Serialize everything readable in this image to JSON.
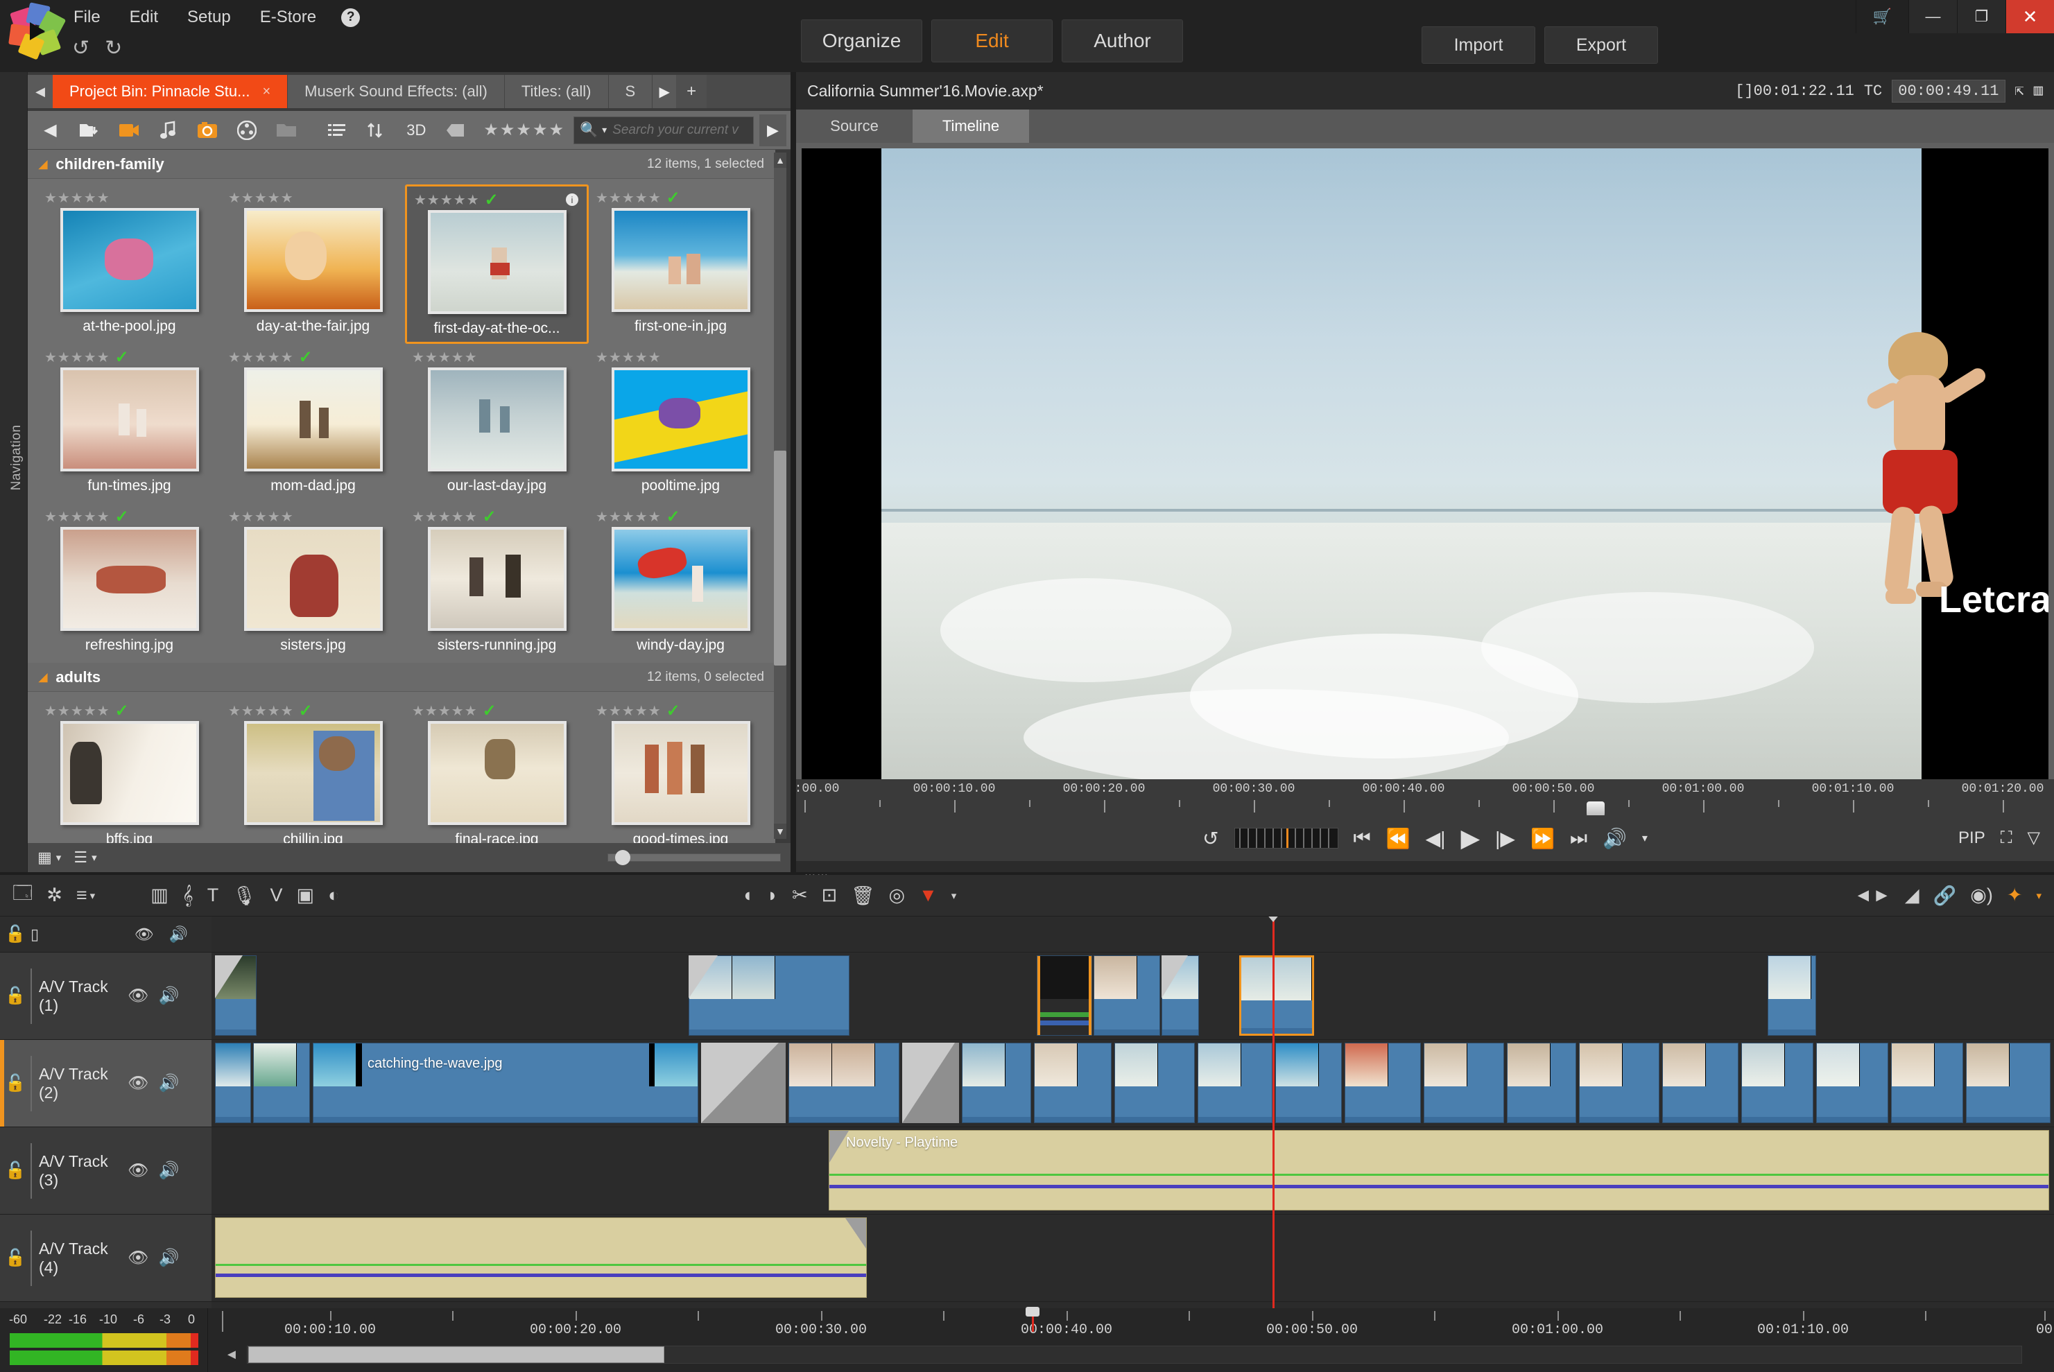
{
  "app": {
    "menu": [
      "File",
      "Edit",
      "Setup",
      "E-Store"
    ],
    "help_icon": "?",
    "undo_icon": "↺",
    "redo_icon": "↻",
    "logo_icon": "pinnacle-logo"
  },
  "modes": [
    {
      "label": "Organize",
      "active": false
    },
    {
      "label": "Edit",
      "active": true
    },
    {
      "label": "Author",
      "active": false
    }
  ],
  "io": [
    {
      "label": "Import"
    },
    {
      "label": "Export"
    }
  ],
  "window_controls": {
    "cart": "🛒",
    "minimize": "—",
    "maximize": "❐",
    "close": "✕"
  },
  "library": {
    "nav_label": "Navigation",
    "tab_scroll_left": "◀",
    "tab_scroll_right": "▶",
    "tab_add": "+",
    "tabs": [
      {
        "label": "Project Bin: Pinnacle Stu...",
        "active": true,
        "close": "×"
      },
      {
        "label": "Muserk Sound Effects: (all)",
        "active": false
      },
      {
        "label": "Titles: (all)",
        "active": false
      },
      {
        "label": "S",
        "active": false
      }
    ],
    "toolbar": [
      {
        "name": "import-folder-icon",
        "glyph": "🗀",
        "accent": false
      },
      {
        "name": "video-icon",
        "glyph": "🎞",
        "accent": true
      },
      {
        "name": "music-note-icon",
        "glyph": "♪",
        "accent": false
      },
      {
        "name": "photo-icon",
        "glyph": "📷",
        "accent": true
      },
      {
        "name": "film-reel-icon",
        "glyph": "◉",
        "accent": false
      },
      {
        "name": "folder-icon",
        "glyph": "🗂",
        "accent": false
      },
      {
        "name": "list-view-icon",
        "glyph": "☰",
        "accent": false
      },
      {
        "name": "sort-icon",
        "glyph": "↑↓",
        "accent": false
      },
      {
        "name": "three-d-icon",
        "glyph": "3D",
        "accent": false
      },
      {
        "name": "tag-icon",
        "glyph": "◧",
        "accent": false
      }
    ],
    "rating_stars": "★★★★★",
    "search": {
      "icon": "search-icon",
      "placeholder": "Search your current v",
      "value": ""
    },
    "groups": [
      {
        "name": "children-family",
        "count_text": "12 items, 1 selected",
        "items": [
          {
            "name": "at-the-pool.jpg",
            "stars": "★★★★★",
            "checked": false,
            "selected": false,
            "info": false,
            "c1": "#1583b6",
            "c2": "#4fb8dd",
            "c3": "#d8719c"
          },
          {
            "name": "day-at-the-fair.jpg",
            "stars": "★★★★★",
            "checked": false,
            "selected": false,
            "info": false,
            "c1": "#f4e4b2",
            "c2": "#e8903a",
            "c3": "#c9601a"
          },
          {
            "name": "first-day-at-the-oc...",
            "stars": "★★★★★",
            "checked": true,
            "selected": true,
            "info": true,
            "c1": "#b9cdd2",
            "c2": "#dfe5e0",
            "c3": "#c23a2c"
          },
          {
            "name": "first-one-in.jpg",
            "stars": "★★★★★",
            "checked": true,
            "selected": false,
            "info": false,
            "c1": "#1c86c4",
            "c2": "#e3e9e2",
            "c3": "#d9c8a8"
          },
          {
            "name": "fun-times.jpg",
            "stars": "★★★★★",
            "checked": true,
            "selected": false,
            "info": false,
            "c1": "#d9c3ae",
            "c2": "#e7cfc0",
            "c3": "#c98e7c"
          },
          {
            "name": "mom-dad.jpg",
            "stars": "★★★★★",
            "checked": true,
            "selected": false,
            "info": false,
            "c1": "#efe2c8",
            "c2": "#f5edd9",
            "c3": "#a9834e"
          },
          {
            "name": "our-last-day.jpg",
            "stars": "★★★★★",
            "checked": false,
            "selected": false,
            "info": false,
            "c1": "#9fb4bd",
            "c2": "#dde4e2",
            "c3": "#6f8894"
          },
          {
            "name": "pooltime.jpg",
            "stars": "★★★★★",
            "checked": false,
            "selected": false,
            "info": false,
            "c1": "#0aa6e8",
            "c2": "#f2d618",
            "c3": "#7b4fa8"
          },
          {
            "name": "refreshing.jpg",
            "stars": "★★★★★",
            "checked": true,
            "selected": false,
            "info": false,
            "c1": "#caa08c",
            "c2": "#ece0d4",
            "c3": "#b4563f"
          },
          {
            "name": "sisters.jpg",
            "stars": "★★★★★",
            "checked": false,
            "selected": false,
            "info": false,
            "c1": "#e7dcc4",
            "c2": "#f0e7d2",
            "c3": "#a13c32"
          },
          {
            "name": "sisters-running.jpg",
            "stars": "★★★★★",
            "checked": true,
            "selected": false,
            "info": false,
            "c1": "#d6cdbb",
            "c2": "#efe9dd",
            "c3": "#4c4038"
          },
          {
            "name": "windy-day.jpg",
            "stars": "★★★★★",
            "checked": true,
            "selected": false,
            "info": false,
            "c1": "#1b8fd0",
            "c2": "#e2d9bf",
            "c3": "#d8342a"
          }
        ]
      },
      {
        "name": "adults",
        "count_text": "12 items, 0 selected",
        "items": [
          {
            "name": "bffs.jpg",
            "stars": "★★★★★",
            "checked": true,
            "selected": false,
            "info": false,
            "c1": "#efe6da",
            "c2": "#f7f2e9",
            "c3": "#3b3630"
          },
          {
            "name": "chillin.jpg",
            "stars": "★★★★★",
            "checked": true,
            "selected": false,
            "info": false,
            "c1": "#cdbf84",
            "c2": "#5b83b8",
            "c3": "#8e6a4c"
          },
          {
            "name": "final-race.jpg",
            "stars": "★★★★★",
            "checked": true,
            "selected": false,
            "info": false,
            "c1": "#e6d9be",
            "c2": "#f1e9d6",
            "c3": "#8a7250"
          },
          {
            "name": "good-times.jpg",
            "stars": "★★★★★",
            "checked": true,
            "selected": false,
            "info": false,
            "c1": "#e4dccb",
            "c2": "#efe9dd",
            "c3": "#b4603f"
          },
          {
            "name": "",
            "stars": "★★★★★",
            "checked": false,
            "selected": false,
            "info": false,
            "c1": "#e2d7c6",
            "c2": "#efe6d9",
            "c3": "#8c7358"
          },
          {
            "name": "",
            "stars": "★★★★★",
            "checked": false,
            "selected": false,
            "info": false,
            "c1": "#ddd3c2",
            "c2": "#ece3d4",
            "c3": "#7e6a55"
          },
          {
            "name": "",
            "stars": "★★★★★",
            "checked": true,
            "selected": false,
            "info": false,
            "c1": "#cfd9d6",
            "c2": "#e8eeea",
            "c3": "#6c7f86"
          },
          {
            "name": "",
            "stars": "★★★★★",
            "checked": false,
            "selected": false,
            "info": false,
            "c1": "#dfd7c6",
            "c2": "#eee7d8",
            "c3": "#a3865f"
          }
        ]
      }
    ],
    "footer": {
      "grid_icon": "▦",
      "grid_caret": "▾",
      "list_icon": "☰",
      "list_caret": "▾",
      "zoom_small": "▫",
      "zoom_large": "▭"
    },
    "scroll": {
      "up": "▲",
      "down": "▼"
    }
  },
  "player": {
    "title": "California Summer'16.Movie.axp*",
    "duration_label": "[]00:01:22.11",
    "tc_label": "TC",
    "tc_value": "00:00:49.11",
    "fullscreen_icon": "⇱",
    "splitview_icon": "▥",
    "tabs": [
      {
        "label": "Source",
        "active": false
      },
      {
        "label": "Timeline",
        "active": true
      }
    ],
    "watermark": "Letcracks.com",
    "ruler_labels": [
      ":00.00",
      "00:00:10.00",
      "00:00:20.00",
      "00:00:30.00",
      "00:00:40.00",
      "00:00:50.00",
      "00:01:00.00",
      "00:01:10.00",
      "00:01:20.00"
    ],
    "transport": [
      {
        "name": "loop-button",
        "glyph": "↺"
      },
      {
        "name": "scrub-wheel",
        "glyph": ""
      },
      {
        "name": "go-to-start-button",
        "glyph": "⏮"
      },
      {
        "name": "previous-clip-button",
        "glyph": "⏪"
      },
      {
        "name": "step-back-button",
        "glyph": "◀|"
      },
      {
        "name": "play-button",
        "glyph": "▶"
      },
      {
        "name": "step-forward-button",
        "glyph": "|▶"
      },
      {
        "name": "next-clip-button",
        "glyph": "⏩"
      },
      {
        "name": "go-to-end-button",
        "glyph": "⏭"
      },
      {
        "name": "audio-mute-button",
        "glyph": "🔊"
      },
      {
        "name": "audio-caret",
        "glyph": "▾"
      }
    ],
    "right_tools": [
      {
        "name": "pip-toggle",
        "glyph": "PIP"
      },
      {
        "name": "expand-view-icon",
        "glyph": "⛶"
      },
      {
        "name": "crop-view-icon",
        "glyph": "▽"
      }
    ]
  },
  "timeline": {
    "toolbar_left": [
      {
        "name": "project-bin-icon",
        "glyph": "🗔"
      },
      {
        "name": "settings-gear-icon",
        "glyph": "✲"
      },
      {
        "name": "track-height-icon",
        "glyph": "≡"
      },
      {
        "name": "track-height-caret",
        "glyph": "▾"
      }
    ],
    "toolbar_mid": [
      {
        "name": "audio-mixer-icon",
        "glyph": "▥"
      },
      {
        "name": "music-icon",
        "glyph": "𝄞"
      },
      {
        "name": "title-editor-icon",
        "glyph": "T"
      },
      {
        "name": "voice-over-icon",
        "glyph": "🎙"
      },
      {
        "name": "chroma-key-icon",
        "glyph": "V"
      },
      {
        "name": "split-screen-icon",
        "glyph": "▣"
      },
      {
        "name": "color-correct-icon",
        "glyph": "◐"
      }
    ],
    "toolbar_center": [
      {
        "name": "mark-in-icon",
        "glyph": "◖"
      },
      {
        "name": "mark-out-icon",
        "glyph": "◗"
      },
      {
        "name": "razor-icon",
        "glyph": "✂"
      },
      {
        "name": "camera-icon",
        "glyph": "⊡"
      },
      {
        "name": "delete-icon",
        "glyph": "🗑"
      },
      {
        "name": "snapshot-icon",
        "glyph": "◎"
      },
      {
        "name": "marker-icon",
        "glyph": "▼"
      },
      {
        "name": "marker-caret",
        "glyph": "▾"
      }
    ],
    "toolbar_right": [
      {
        "name": "transition-icon",
        "glyph": "◄►"
      },
      {
        "name": "fade-icon",
        "glyph": "◢"
      },
      {
        "name": "link-icon",
        "glyph": "🔗"
      },
      {
        "name": "audio-wave-icon",
        "glyph": "◉)"
      },
      {
        "name": "effects-icon",
        "glyph": "✦"
      },
      {
        "name": "effects-caret",
        "glyph": "▾"
      }
    ],
    "master_track": {
      "lock_icon": "🔓",
      "monitor_icon": "▯",
      "eye_icon": "👁",
      "speaker_icon": "🔊"
    },
    "tracks": [
      {
        "label": "A/V Track (1)",
        "active": false,
        "lock": "🔓",
        "eye": "👁",
        "speaker": "🔊"
      },
      {
        "label": "A/V Track (2)",
        "active": true,
        "lock": "🔓",
        "eye": "👁",
        "speaker": "🔊"
      },
      {
        "label": "A/V Track (3)",
        "active": false,
        "lock": "🔓",
        "eye": "👁",
        "speaker": "🔊"
      },
      {
        "label": "A/V Track (4)",
        "active": false,
        "lock": "🔓",
        "eye": "👁",
        "speaker": "🔊"
      }
    ],
    "clips": {
      "named": [
        {
          "label": "catching-the-wave.jpg",
          "track": 2
        },
        {
          "label": "Novelty - Playtime",
          "track": 3
        }
      ]
    },
    "ruler_labels": [
      "00:00:10.00",
      "00:00:20.00",
      "00:00:30.00",
      "00:00:40.00",
      "00:00:50.00",
      "00:01:00.00",
      "00:01:10.00",
      "00"
    ],
    "audio_meter_scale": [
      "-60",
      "-22",
      "-16",
      "-10",
      "-6",
      "-3",
      "0"
    ],
    "scroll_left_arrow": "◄"
  },
  "colors": {
    "accent_orange": "#f0941f",
    "tab_active": "#f24a16",
    "clip_blue": "#4a7fae",
    "music_tan": "#d9cfa0",
    "playhead_red": "#e02a1f",
    "check_green": "#3fcb2f",
    "close_red": "#d23b2d"
  }
}
